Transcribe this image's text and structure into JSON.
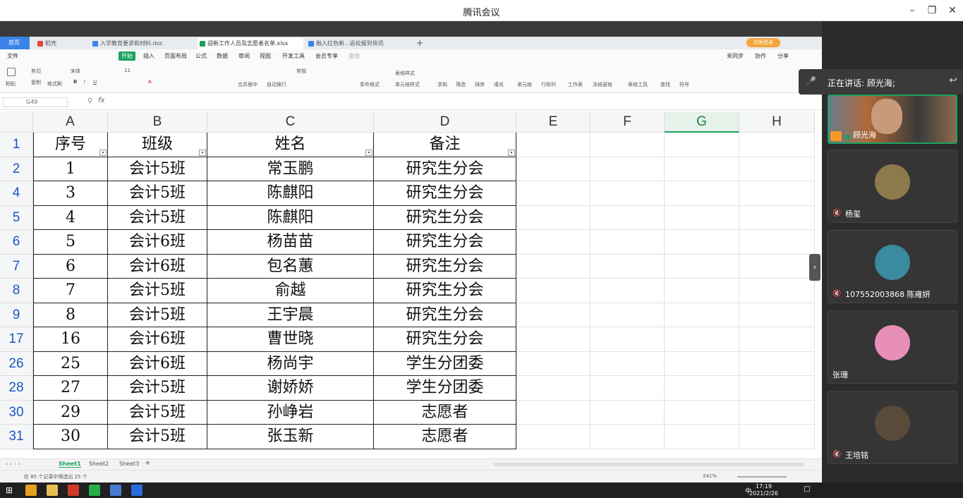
{
  "window": {
    "title": "腾讯会议"
  },
  "browser_tabs": [
    {
      "label": "首页"
    },
    {
      "label": "稻壳"
    },
    {
      "label": "入学教育要求和材料.doc"
    },
    {
      "label": "迎新工作人员及志愿者名单.xlsx"
    },
    {
      "label": "融入红色新...返校报到快讯"
    }
  ],
  "user_badge": "访客登录",
  "menu": {
    "items": [
      "文件",
      "开始",
      "插入",
      "页面布局",
      "公式",
      "数据",
      "审阅",
      "视图",
      "开发工具",
      "会员专享",
      "查找"
    ],
    "right_items": [
      "未同步",
      "协作",
      "分享"
    ]
  },
  "ribbon": {
    "paste": "粘贴",
    "cut": "剪切",
    "copy": "复制",
    "format_painter": "格式刷",
    "font": "宋体",
    "font_size": "11",
    "number_format": "常规",
    "merge": "合并居中",
    "wrap": "自动换行",
    "cond_format": "条件格式",
    "table_style": "表格样式",
    "cell_style": "单元格样式",
    "sum": "求和",
    "filter": "筛选",
    "sort": "排序",
    "fill": "填充",
    "cell": "单元格",
    "rowcol": "行和列",
    "worksheet": "工作表",
    "freeze": "冻结窗格",
    "table_tools": "表格工具",
    "find": "查找",
    "symbol": "符号"
  },
  "formula_bar": {
    "cell_ref": "G49",
    "fx": "fx"
  },
  "columns": [
    "A",
    "B",
    "C",
    "D",
    "E",
    "F",
    "G",
    "H"
  ],
  "table": {
    "header_row_number": "1",
    "headers": [
      "序号",
      "班级",
      "姓名",
      "备注"
    ],
    "rows": [
      {
        "row": "2",
        "cells": [
          "1",
          "会计5班",
          "常玉鹏",
          "研究生分会"
        ]
      },
      {
        "row": "4",
        "cells": [
          "3",
          "会计5班",
          "陈麒阳",
          "研究生分会"
        ]
      },
      {
        "row": "5",
        "cells": [
          "4",
          "会计5班",
          "陈麒阳",
          "研究生分会"
        ]
      },
      {
        "row": "6",
        "cells": [
          "5",
          "会计6班",
          "杨苗苗",
          "研究生分会"
        ]
      },
      {
        "row": "7",
        "cells": [
          "6",
          "会计6班",
          "包名蕙",
          "研究生分会"
        ]
      },
      {
        "row": "8",
        "cells": [
          "7",
          "会计5班",
          "俞越",
          "研究生分会"
        ]
      },
      {
        "row": "9",
        "cells": [
          "8",
          "会计5班",
          "王宇晨",
          "研究生分会"
        ]
      },
      {
        "row": "17",
        "cells": [
          "16",
          "会计6班",
          "曹世晓",
          "研究生分会"
        ]
      },
      {
        "row": "26",
        "cells": [
          "25",
          "会计6班",
          "杨尚宇",
          "学生分团委"
        ]
      },
      {
        "row": "28",
        "cells": [
          "27",
          "会计5班",
          "谢娇娇",
          "学生分团委"
        ]
      },
      {
        "row": "30",
        "cells": [
          "29",
          "会计5班",
          "孙峥岩",
          "志愿者"
        ]
      },
      {
        "row": "31",
        "cells": [
          "30",
          "会计5班",
          "张玉新",
          "志愿者"
        ]
      }
    ]
  },
  "sheets": [
    "Sheet1",
    "Sheet2",
    "Sheet3"
  ],
  "status": {
    "text": "在 85 个记录中筛选出 25 个",
    "zoom": "241%"
  },
  "meeting": {
    "speaking_label": "正在讲话: 顾光海;",
    "participants": [
      {
        "name": "顾光海",
        "avatar_color": "#7a5a3a"
      },
      {
        "name": "杨玺",
        "avatar_color": "#8c7a4a"
      },
      {
        "name": "107552003868 陈雍妍",
        "avatar_color": "#3a8aa0"
      },
      {
        "name": "张珊",
        "avatar_color": "#e88fb8"
      },
      {
        "name": "王培铭",
        "avatar_color": "#5a4a3a"
      }
    ]
  },
  "taskbar": {
    "time": "17:19",
    "date": "2021/2/26",
    "ime": "中"
  },
  "colors": {
    "accent_green": "#1aa261",
    "wps_blue": "#3b83e8",
    "row_number_blue": "#1a56c4"
  }
}
